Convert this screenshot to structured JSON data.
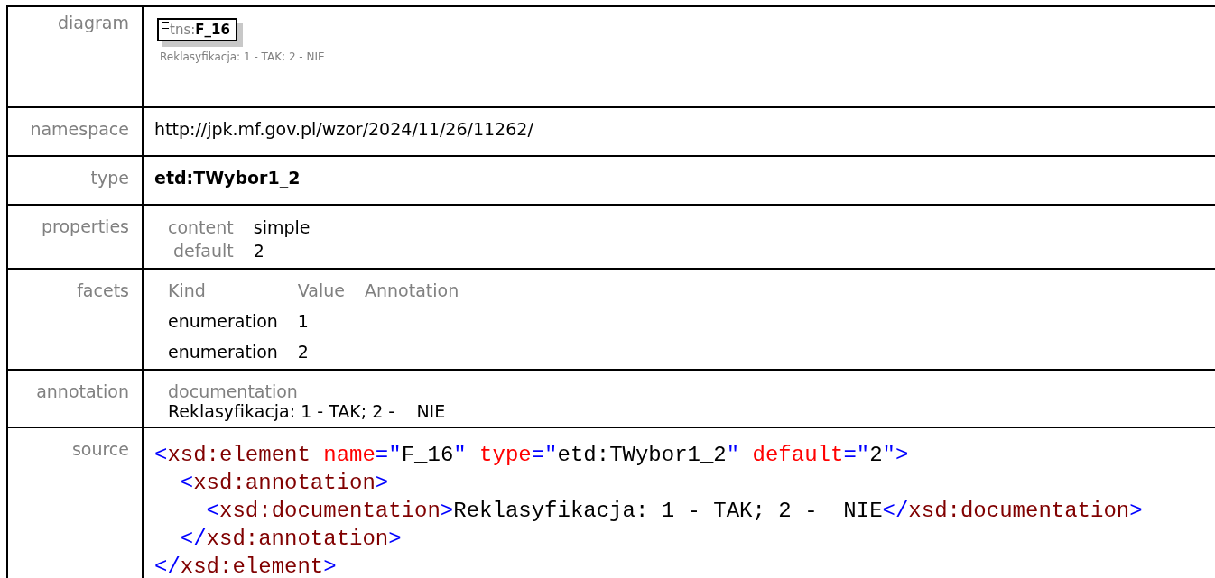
{
  "diagram": {
    "prefix": "tns:",
    "name": "F_16",
    "caption": "Reklasyfikacja: 1 - TAK; 2 - NIE"
  },
  "rows": [
    {
      "label": "diagram",
      "kind": "diagram"
    },
    {
      "label": "namespace",
      "kind": "text",
      "value": "http://jpk.mf.gov.pl/wzor/2024/11/26/11262/"
    },
    {
      "label": "type",
      "kind": "bold",
      "value": "etd:TWybor1_2"
    },
    {
      "label": "properties",
      "kind": "properties",
      "items": [
        {
          "key": "content",
          "value": "simple"
        },
        {
          "key": "default",
          "value": "2"
        }
      ]
    },
    {
      "label": "facets",
      "kind": "facets",
      "columns": [
        "Kind",
        "Value",
        "Annotation"
      ],
      "items": [
        {
          "kind": "enumeration",
          "value": "1"
        },
        {
          "kind": "enumeration",
          "value": "2"
        }
      ]
    },
    {
      "label": "annotation",
      "kind": "annotation",
      "heading": "documentation",
      "value": "Reklasyfikacja: 1 - TAK; 2 -    NIE"
    },
    {
      "label": "source",
      "kind": "source"
    }
  ],
  "source_lines": [
    [
      {
        "t": "<",
        "kind": "punct"
      },
      {
        "t": "xsd:element",
        "kind": "tag"
      },
      {
        "t": " name",
        "kind": "attr"
      },
      {
        "t": "=\"",
        "kind": "punct"
      },
      {
        "t": "F_16",
        "kind": "value"
      },
      {
        "t": "\"",
        "kind": "punct"
      },
      {
        "t": " type",
        "kind": "attr"
      },
      {
        "t": "=\"",
        "kind": "punct"
      },
      {
        "t": "etd:TWybor1_2",
        "kind": "value"
      },
      {
        "t": "\"",
        "kind": "punct"
      },
      {
        "t": " default",
        "kind": "attr"
      },
      {
        "t": "=\"",
        "kind": "punct"
      },
      {
        "t": "2",
        "kind": "value"
      },
      {
        "t": "\">",
        "kind": "punct"
      }
    ],
    [
      {
        "t": "  <",
        "kind": "punct"
      },
      {
        "t": "xsd:annotation",
        "kind": "tag"
      },
      {
        "t": ">",
        "kind": "punct"
      }
    ],
    [
      {
        "t": "    <",
        "kind": "punct"
      },
      {
        "t": "xsd:documentation",
        "kind": "tag"
      },
      {
        "t": ">",
        "kind": "punct"
      },
      {
        "t": "Reklasyfikacja: 1 - TAK; 2 -  NIE",
        "kind": "text"
      },
      {
        "t": "</",
        "kind": "punct"
      },
      {
        "t": "xsd:documentation",
        "kind": "tag"
      },
      {
        "t": ">",
        "kind": "punct"
      }
    ],
    [
      {
        "t": "  </",
        "kind": "punct"
      },
      {
        "t": "xsd:annotation",
        "kind": "tag"
      },
      {
        "t": ">",
        "kind": "punct"
      }
    ],
    [
      {
        "t": "</",
        "kind": "punct"
      },
      {
        "t": "xsd:element",
        "kind": "tag"
      },
      {
        "t": ">",
        "kind": "punct"
      }
    ]
  ]
}
